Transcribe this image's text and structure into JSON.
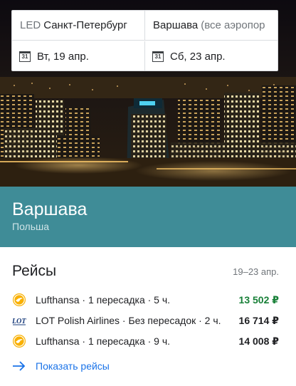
{
  "search": {
    "origin_code": "LED",
    "origin_city": "Санкт-Петербург",
    "destination_city": "Варшава",
    "destination_hint": "(все аэропор",
    "depart_date": "Вт, 19 апр.",
    "return_date": "Сб, 23 апр.",
    "calendar_glyph": "31"
  },
  "destination": {
    "city": "Варшава",
    "country": "Польша"
  },
  "flights": {
    "heading": "Рейсы",
    "date_range": "19–23 апр.",
    "items": [
      {
        "airline": "Lufthansa",
        "details": " · 1 пересадка · 5 ч.",
        "price": "13 502 ₽",
        "price_color": "#188038",
        "logo": "lufthansa-crane-icon"
      },
      {
        "airline": "LOT Polish Airlines",
        "details": " · Без пересадок · 2 ч.",
        "price": "16 714 ₽",
        "price_color": "#202124",
        "logo": "lot-logo-icon"
      },
      {
        "airline": "Lufthansa",
        "details": " · 1 пересадка · 9 ч.",
        "price": "14 008 ₽",
        "price_color": "#202124",
        "logo": "lufthansa-crane-icon"
      }
    ],
    "show_link": "Показать рейсы"
  },
  "colors": {
    "band": "#3f8c97",
    "link": "#1a73e8",
    "cheapest_price": "#188038"
  }
}
